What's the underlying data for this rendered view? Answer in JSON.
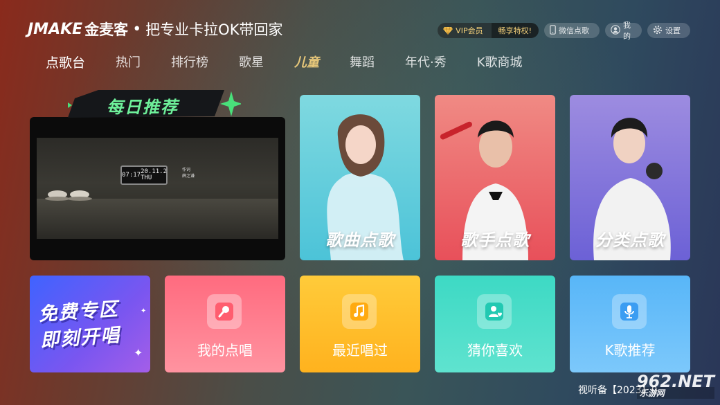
{
  "header": {
    "logo_mark": "JMAKE",
    "logo_cn": "金麦客",
    "dot": "•",
    "slogan": "把专业卡拉OK带回家"
  },
  "top_right": {
    "vip_label": "VIP会员",
    "vip_promo": "畅享特权!",
    "wechat_label": "微信点歌",
    "mine_label": "我的",
    "settings_label": "设置"
  },
  "nav": {
    "items": [
      {
        "label": "点歌台"
      },
      {
        "label": "热门"
      },
      {
        "label": "排行榜"
      },
      {
        "label": "歌星"
      },
      {
        "label": "儿童"
      },
      {
        "label": "舞蹈"
      },
      {
        "label": "年代·秀"
      },
      {
        "label": "K歌商城"
      }
    ]
  },
  "daily": {
    "title": "每日推荐",
    "clock_time": "07:17",
    "clock_date": "20.11.2",
    "clock_day": "THU",
    "lyric_line1": "作词",
    "lyric_line2": "薛之谦"
  },
  "cards": [
    {
      "label": "歌曲点歌",
      "color": "#4cc3d8"
    },
    {
      "label": "歌手点歌",
      "color": "#e8505a"
    },
    {
      "label": "分类点歌",
      "color": "#6c61d6"
    }
  ],
  "tiles": {
    "free_line1": "免费专区",
    "free_line2": "即刻开唱",
    "items": [
      {
        "label": "我的点唱",
        "icon": "microphone-icon"
      },
      {
        "label": "最近唱过",
        "icon": "music-note-icon"
      },
      {
        "label": "猜你喜欢",
        "icon": "user-heart-icon"
      },
      {
        "label": "K歌推荐",
        "icon": "mic-stand-icon"
      }
    ]
  },
  "footer": {
    "text": "视听备【2023】0"
  },
  "watermark": {
    "main": "962.NET",
    "sub": "乐游网"
  }
}
